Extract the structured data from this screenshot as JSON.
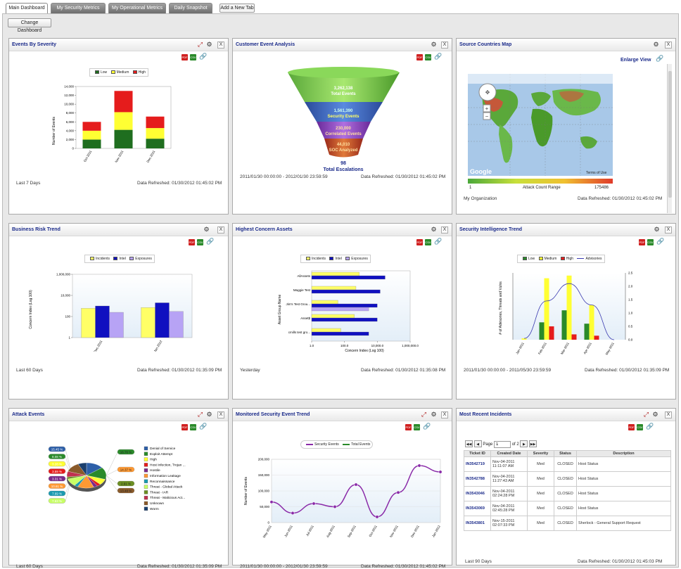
{
  "tabs": [
    {
      "label": "Main Dashboard",
      "active": true
    },
    {
      "label": "My Security Metrics"
    },
    {
      "label": "My Operational Metrics"
    },
    {
      "label": "Daily Snapshot"
    }
  ],
  "add_tab_label": "Add a New Tab",
  "change_dashboard_label": "Change Dashboard",
  "icons": {
    "pdf": "PDF",
    "csv": "CSV",
    "close": "X",
    "gear": "⚙"
  },
  "panels": {
    "events_by_severity": {
      "title": "Events By Severity",
      "footer_left": "Last 7 Days",
      "footer_right": "Data Refreshed: 01/30/2012 01:45:02 PM",
      "legend": [
        "Low",
        "Medium",
        "High"
      ],
      "ylabel": "Number of Events",
      "yticks": [
        "14,000",
        "12,000",
        "10,000",
        "8,000",
        "6,000",
        "4,000",
        "2,000",
        "0"
      ]
    },
    "customer_event": {
      "title": "Customer Event Analysis",
      "footer_left": "2011/01/30 00:00:00 - 2012/01/30 23:59:59",
      "footer_right": "Data Refreshed: 01/30/2012 01:45:02 PM",
      "layers": [
        {
          "value": "3,262,138",
          "label": "Total Events"
        },
        {
          "value": "1,561,390",
          "label": "Security Events"
        },
        {
          "value": "230,000",
          "label": "Correlated Events"
        },
        {
          "value": "44,010",
          "label": "SOC Analyzed"
        }
      ],
      "escalation_value": "98",
      "escalation_label": "Total Escalations"
    },
    "source_map": {
      "title": "Source Countries Map",
      "enlarge_label": "Enlarge View",
      "range_min": "1",
      "range_label": "Attack Count Range",
      "range_max": "175486",
      "google_label": "Google",
      "terms_label": "Terms of Use",
      "footer_left": "My Organization",
      "footer_right": "Data Refreshed: 01/30/2012 01:45:02 PM"
    },
    "business_risk": {
      "title": "Business Risk Trend",
      "legend": [
        "Incidents",
        "Intel",
        "Exposures"
      ],
      "ylabel": "Concern Index (Log 100)",
      "yticks": [
        "1,000,000",
        "10,000",
        "100",
        "1"
      ],
      "footer_left": "Last 60 Days",
      "footer_right": "Data Refreshed: 01/30/2012 01:35:09 PM"
    },
    "highest_concern": {
      "title": "Highest Concern Assets",
      "legend": [
        "Incidents",
        "Intel",
        "Exposures"
      ],
      "ylabel": "Asset Group Name",
      "xlabel": "Concern Index (Log 100)",
      "xticks": [
        "1.0",
        "100.0",
        "10,000.0",
        "1,000,000.0"
      ],
      "footer_left": "Yesterday",
      "footer_right": "Data Refreshed: 01/30/2012 01:35:08 PM"
    },
    "sec_intel": {
      "title": "Security Intelligence Trend",
      "legend": [
        "Low",
        "Medium",
        "High",
        "Advisories"
      ],
      "ylabel": "# of Advisories, Threats and Vulns",
      "yticks_right": [
        "2.5",
        "2.0",
        "1.5",
        "1.0",
        "0.5",
        "0.0"
      ],
      "footer_left": "2011/01/30 00:00:00 - 2011/05/30 23:59:59",
      "footer_right": "Data Refreshed: 01/30/2012 01:35:09 PM"
    },
    "attack_events": {
      "title": "Attack Events",
      "left_labels": [
        "15.45 %",
        "8.08 %",
        "3.28 %",
        "3.59 %",
        "3.31 %",
        "10.61 %",
        "7.69 %",
        "7.63 %"
      ],
      "right_labels": [
        "16.76 %",
        "14.37 %",
        "2.91 %",
        "13.48 %"
      ],
      "legend": [
        "Denial of Service",
        "Exploit Attempt",
        "High",
        "Host Infection, Trojan ...",
        "Hostile",
        "Information Leakage",
        "Reconnaissance",
        "Threat - Global Attack",
        "Threat - IAR",
        "Threat - Malicious Act...",
        "Unknown",
        "Worm"
      ],
      "footer_left": "Last 60 Days",
      "footer_right": "Data Refreshed: 01/30/2012 01:35:09 PM"
    },
    "monitored_trend": {
      "title": "Monitored Security Event Trend",
      "legend": [
        "Security Events",
        "Total Events"
      ],
      "ylabel": "Number of Events",
      "yticks": [
        "200,000",
        "150,000",
        "100,000",
        "50,000",
        "0"
      ],
      "footer_left": "2011/01/30 00:00:00 - 2012/01/30 23:59:59",
      "footer_right": "Data Refreshed: 01/30/2012 01:45:02 PM"
    },
    "incidents": {
      "title": "Most Recent Incidents",
      "page_label": "Page",
      "page_value": "1",
      "page_of": "of 2",
      "headers": [
        "Ticket ID",
        "Created Date",
        "Severity",
        "Status",
        "Description"
      ],
      "rows": [
        {
          "id": "IN3542719",
          "date": "Nov-04-2011 11:11:07 AM",
          "sev": "Med",
          "status": "CLOSED",
          "desc": "Host Status"
        },
        {
          "id": "IN3542788",
          "date": "Nov-04-2011 11:27:43 AM",
          "sev": "Med",
          "status": "CLOSED",
          "desc": "Host Status"
        },
        {
          "id": "IN3543046",
          "date": "Nov-04-2011 02:24:28 PM",
          "sev": "Med",
          "status": "CLOSED",
          "desc": "Host Status"
        },
        {
          "id": "IN3543069",
          "date": "Nov-04-2011 02:45:28 PM",
          "sev": "Med",
          "status": "CLOSED",
          "desc": "Host Status"
        },
        {
          "id": "IN3543801",
          "date": "Nov-15-2011 02:07:33 PM",
          "sev": "Med",
          "status": "CLOSED",
          "desc": "Sherlock - General Support Request"
        }
      ],
      "footer_left": "Last 90 Days",
      "footer_right": "Data Refreshed: 01/30/2012 01:45:03 PM"
    }
  },
  "chart_data": [
    {
      "type": "bar",
      "title": "Events By Severity",
      "categories": [
        "Oct-2011",
        "Nov-2011",
        "Dec-2011"
      ],
      "stacked": true,
      "series": [
        {
          "name": "Low",
          "values": [
            2000,
            4200,
            2200
          ],
          "color": "#1f6e1f"
        },
        {
          "name": "Medium",
          "values": [
            2000,
            4000,
            2400
          ],
          "color": "#ffff33"
        },
        {
          "name": "High",
          "values": [
            2000,
            4800,
            2600
          ],
          "color": "#e51c1c"
        }
      ],
      "ylabel": "Number of Events",
      "ylim": [
        0,
        14000
      ]
    },
    {
      "type": "bar",
      "title": "Business Risk Trend",
      "categories": [
        "Dec-2011",
        "Jan-2012"
      ],
      "log_scale": true,
      "series": [
        {
          "name": "Incidents",
          "values": [
            600,
            700
          ],
          "color": "#ffff66"
        },
        {
          "name": "Intel",
          "values": [
            1000,
            2000
          ],
          "color": "#1010c0"
        },
        {
          "name": "Exposures",
          "values": [
            250,
            300
          ],
          "color": "#b7a3f5"
        }
      ],
      "ylabel": "Concern Index (Log 100)",
      "ylim": [
        1,
        1000000
      ]
    },
    {
      "type": "bar",
      "orientation": "horizontal",
      "title": "Highest Concern Assets",
      "categories": [
        "AllAssets",
        "Maggie Test",
        "Jim's Test Grou...",
        "Asset$",
        "cmills test gro..."
      ],
      "log_scale": true,
      "series": [
        {
          "name": "Incidents",
          "values": [
            800,
            500,
            40,
            400,
            60
          ],
          "color": "#ffff66"
        },
        {
          "name": "Intel",
          "values": [
            30000,
            15000,
            10000,
            10000,
            3000
          ],
          "color": "#1010c0"
        },
        {
          "name": "Exposures",
          "values": [
            0,
            0,
            3000,
            0,
            0
          ],
          "color": "#b7a3f5"
        }
      ],
      "xlabel": "Concern Index (Log 100)",
      "xlim": [
        1,
        1000000
      ]
    },
    {
      "type": "bar",
      "title": "Security Intelligence Trend",
      "categories": [
        "Jan-2011",
        "Feb-2011",
        "Mar-2011",
        "Apr-2011",
        "May-2011"
      ],
      "series": [
        {
          "name": "Low",
          "values": [
            0,
            0.65,
            1.1,
            0.6,
            0
          ],
          "color": "#2a8a2a"
        },
        {
          "name": "Medium",
          "values": [
            0.05,
            2.3,
            2.4,
            1.3,
            0
          ],
          "color": "#ffff33"
        },
        {
          "name": "High",
          "values": [
            0,
            0.5,
            0.2,
            0.15,
            0
          ],
          "color": "#e51c1c"
        },
        {
          "name": "Advisories",
          "type": "line",
          "values": [
            0.05,
            1.45,
            2.1,
            1.3,
            0
          ],
          "color": "#3a3ab0"
        }
      ],
      "ylim_right": [
        0,
        2.5
      ]
    },
    {
      "type": "pie",
      "title": "Attack Events",
      "labels": [
        "Denial of Service",
        "Exploit Attempt",
        "High",
        "Host Infection, Trojan ...",
        "Hostile",
        "Information Leakage",
        "Reconnaissance",
        "Threat - Global Attack",
        "Threat - IAR",
        "Threat - Malicious Act...",
        "Unknown",
        "Worm"
      ],
      "values": [
        15.45,
        16.76,
        8.08,
        3.28,
        3.59,
        14.37,
        3.31,
        10.61,
        2.91,
        7.69,
        13.48,
        7.63
      ],
      "colors": [
        "#2d5fa8",
        "#2a8a2a",
        "#ffff33",
        "#e51c1c",
        "#7a2a8a",
        "#ff9933",
        "#1a9ab0",
        "#c8ff66",
        "#6b8e23",
        "#c03050",
        "#8a5a2a",
        "#1a3f6e"
      ]
    },
    {
      "type": "line",
      "title": "Monitored Security Event Trend",
      "categories": [
        "May-2011",
        "Jun-2011",
        "Jul-2011",
        "Aug-2011",
        "Sep-2011",
        "Oct-2011",
        "Nov-2011",
        "Dec-2011",
        "Jan-2012"
      ],
      "series": [
        {
          "name": "Security Events",
          "values": [
            65000,
            30000,
            60000,
            50000,
            120000,
            18000,
            95000,
            180000,
            160000
          ],
          "color": "#8a2aa8"
        }
      ],
      "ylabel": "Number of Events",
      "ylim": [
        0,
        200000
      ]
    }
  ]
}
